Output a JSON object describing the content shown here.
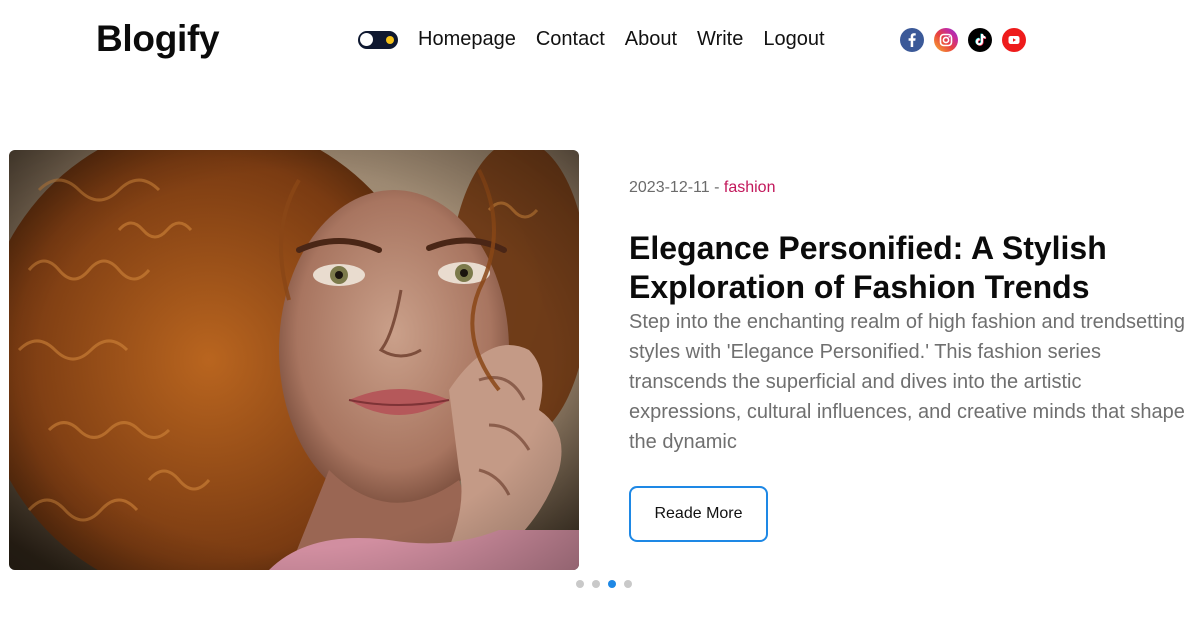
{
  "brand": {
    "name": "Blogify"
  },
  "header": {
    "theme_toggle": {
      "state": "dark"
    },
    "nav": [
      {
        "label": "Homepage"
      },
      {
        "label": "Contact"
      },
      {
        "label": "About"
      },
      {
        "label": "Write"
      },
      {
        "label": "Logout"
      }
    ],
    "socials": [
      {
        "icon": "facebook-icon",
        "color": "#3b5998"
      },
      {
        "icon": "instagram-icon",
        "color": "#e1306c"
      },
      {
        "icon": "tiktok-icon",
        "color": "#000000"
      },
      {
        "icon": "youtube-icon",
        "color": "#ee1b1b"
      }
    ]
  },
  "featured_post": {
    "date": "2023-12-11",
    "separator": " - ",
    "category": "fashion",
    "title": "Elegance Personified: A Stylish Exploration of Fashion Trends",
    "excerpt": "Step into the enchanting realm of high fashion and trendsetting styles with 'Elegance Personified.' This fashion series transcends the superficial and dives into the artistic expressions, cultural influences, and creative minds that shape the dynamic",
    "cta": "Reade More",
    "image": "portrait-photo"
  },
  "carousel": {
    "count": 4,
    "active_index": 2
  },
  "colors": {
    "accent": "#1e88e5",
    "category": "#c2185b",
    "text_muted": "#6f6f6f"
  }
}
